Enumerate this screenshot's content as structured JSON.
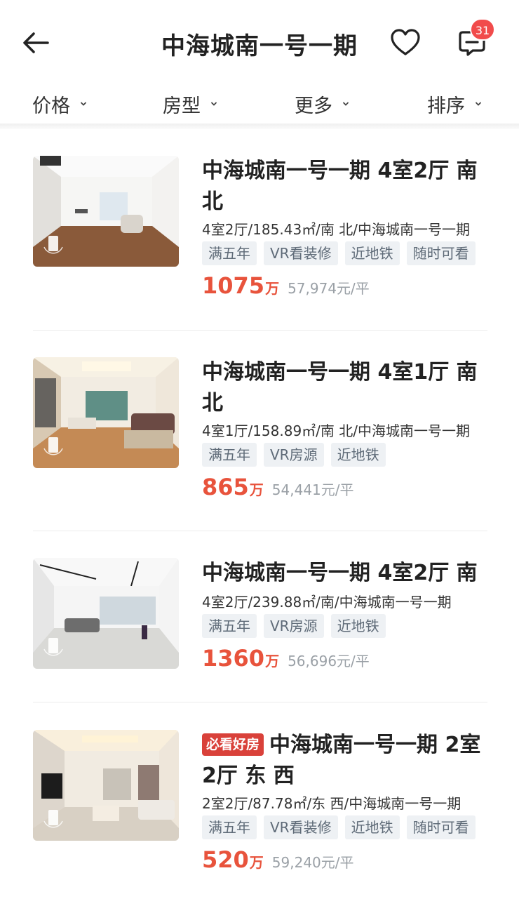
{
  "header": {
    "title": "中海城南一号一期",
    "back_icon": "arrow-left-icon",
    "favorite_icon": "heart-icon",
    "message_icon": "chat-icon",
    "message_count": "31"
  },
  "filters": [
    {
      "label": "价格"
    },
    {
      "label": "房型"
    },
    {
      "label": "更多"
    },
    {
      "label": "排序"
    }
  ],
  "listings": [
    {
      "title": "中海城南一号一期 4室2厅 南北",
      "meta": "4室2厅/185.43㎡/南 北/中海城南一号一期",
      "tags": [
        "满五年",
        "VR看装修",
        "近地铁",
        "随时可看"
      ],
      "price": "1075",
      "price_unit": "万",
      "unit_price": "57,974元/平"
    },
    {
      "title": "中海城南一号一期 4室1厅 南北",
      "meta": "4室1厅/158.89㎡/南 北/中海城南一号一期",
      "tags": [
        "满五年",
        "VR房源",
        "近地铁"
      ],
      "price": "865",
      "price_unit": "万",
      "unit_price": "54,441元/平"
    },
    {
      "title": "中海城南一号一期 4室2厅 南",
      "meta": "4室2厅/239.88㎡/南/中海城南一号一期",
      "tags": [
        "满五年",
        "VR房源",
        "近地铁"
      ],
      "price": "1360",
      "price_unit": "万",
      "unit_price": "56,696元/平"
    },
    {
      "badge": "必看好房",
      "title": "中海城南一号一期 2室2厅 东 西",
      "meta": "2室2厅/87.78㎡/东 西/中海城南一号一期",
      "tags": [
        "满五年",
        "VR看装修",
        "近地铁",
        "随时可看"
      ],
      "price": "520",
      "price_unit": "万",
      "unit_price": "59,240元/平"
    }
  ],
  "colors": {
    "price": "#e8533c",
    "badge": "#d9413a",
    "tag_bg": "#eef1f4",
    "tag_text": "#5f6b78"
  }
}
